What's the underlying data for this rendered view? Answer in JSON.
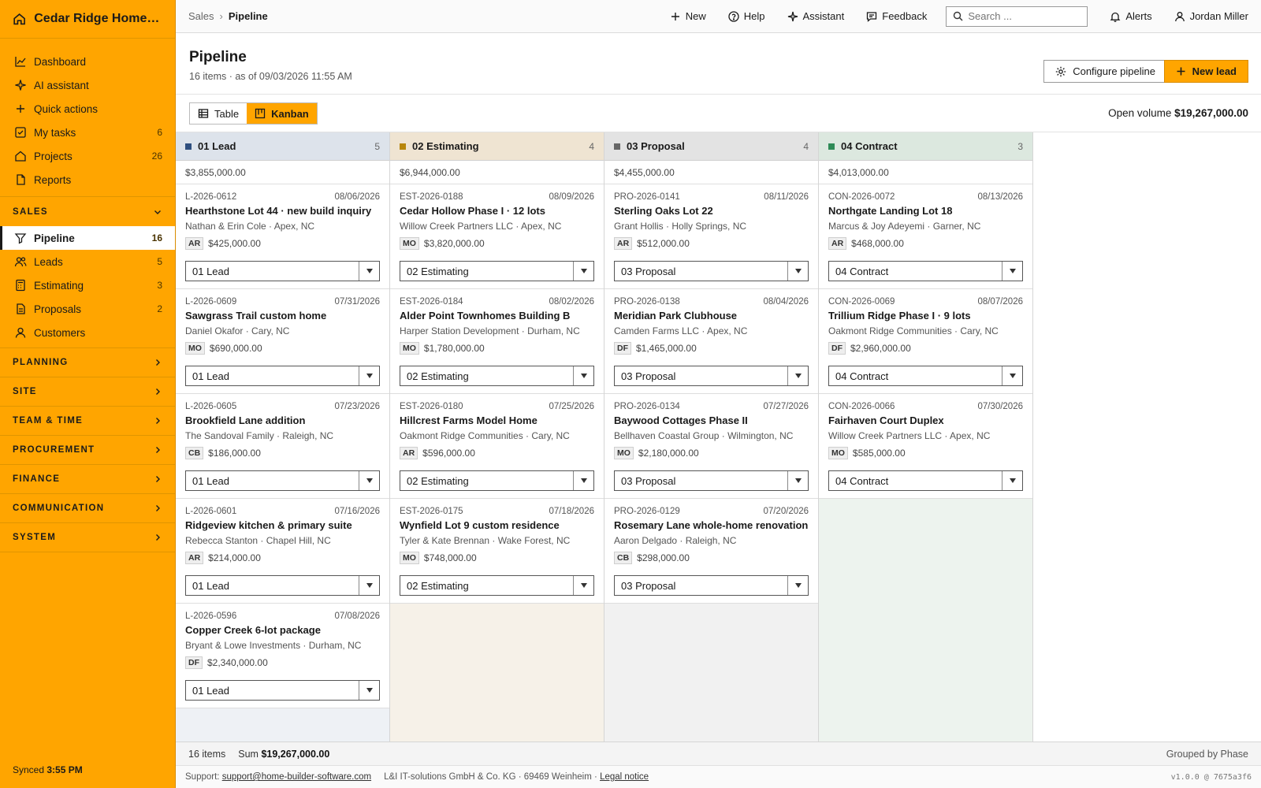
{
  "app": {
    "brand": "Cedar Ridge Homes L...",
    "synced_label": "Synced",
    "synced_time": "3:55 PM"
  },
  "sidebar": {
    "top_items": [
      {
        "label": "Dashboard",
        "icon": "chart-line-icon"
      },
      {
        "label": "AI assistant",
        "icon": "sparkle-icon"
      },
      {
        "label": "Quick actions",
        "icon": "plus-icon"
      },
      {
        "label": "My tasks",
        "icon": "checkbox-icon",
        "count": "6"
      },
      {
        "label": "Projects",
        "icon": "home-icon",
        "count": "26"
      },
      {
        "label": "Reports",
        "icon": "document-icon"
      }
    ],
    "sales_section": "SALES",
    "sales_items": [
      {
        "label": "Pipeline",
        "icon": "filter-icon",
        "count": "16",
        "active": true
      },
      {
        "label": "Leads",
        "icon": "users-icon",
        "count": "5"
      },
      {
        "label": "Estimating",
        "icon": "calculator-icon",
        "count": "3"
      },
      {
        "label": "Proposals",
        "icon": "file-icon",
        "count": "2"
      },
      {
        "label": "Customers",
        "icon": "user-icon"
      }
    ],
    "sections": [
      "PLANNING",
      "SITE",
      "TEAM & TIME",
      "PROCUREMENT",
      "FINANCE",
      "COMMUNICATION",
      "SYSTEM"
    ]
  },
  "topbar": {
    "breadcrumb_parent": "Sales",
    "breadcrumb_current": "Pipeline",
    "new_label": "New",
    "help_label": "Help",
    "assistant_label": "Assistant",
    "feedback_label": "Feedback",
    "search_placeholder": "Search ...",
    "alerts_label": "Alerts",
    "user_name": "Jordan Miller"
  },
  "header": {
    "title": "Pipeline",
    "subtitle": "16 items · as of 09/03/2026 11:55 AM",
    "configure_label": "Configure pipeline",
    "new_lead_label": "New lead"
  },
  "view": {
    "table_label": "Table",
    "kanban_label": "Kanban",
    "open_volume_label": "Open volume",
    "open_volume_value": "$19,267,000.00"
  },
  "colors": {
    "accent": "#ffa500",
    "lead": "#2f4f7f",
    "estimating": "#b8860b",
    "proposal": "#666666",
    "contract": "#2e8b57"
  },
  "columns": [
    {
      "name": "01 Lead",
      "count": "5",
      "sum": "$3,855,000.00",
      "head_bg": "#dde3eb",
      "body_bg": "#eef1f5",
      "dot": "#2f4f7f",
      "cards": [
        {
          "ref": "L-2026-0612",
          "date": "08/06/2026",
          "title": "Hearthstone Lot 44 · new build inquiry",
          "client": "Nathan & Erin Cole · Apex, NC",
          "owner": "AR",
          "value": "$425,000.00",
          "stage": "01 Lead"
        },
        {
          "ref": "L-2026-0609",
          "date": "07/31/2026",
          "title": "Sawgrass Trail custom home",
          "client": "Daniel Okafor · Cary, NC",
          "owner": "MO",
          "value": "$690,000.00",
          "stage": "01 Lead"
        },
        {
          "ref": "L-2026-0605",
          "date": "07/23/2026",
          "title": "Brookfield Lane addition",
          "client": "The Sandoval Family · Raleigh, NC",
          "owner": "CB",
          "value": "$186,000.00",
          "stage": "01 Lead"
        },
        {
          "ref": "L-2026-0601",
          "date": "07/16/2026",
          "title": "Ridgeview kitchen & primary suite",
          "client": "Rebecca Stanton · Chapel Hill, NC",
          "owner": "AR",
          "value": "$214,000.00",
          "stage": "01 Lead"
        },
        {
          "ref": "L-2026-0596",
          "date": "07/08/2026",
          "title": "Copper Creek 6-lot package",
          "client": "Bryant & Lowe Investments · Durham, NC",
          "owner": "DF",
          "value": "$2,340,000.00",
          "stage": "01 Lead"
        }
      ]
    },
    {
      "name": "02 Estimating",
      "count": "4",
      "sum": "$6,944,000.00",
      "head_bg": "#efe4d2",
      "body_bg": "#f6f1e8",
      "dot": "#b8860b",
      "cards": [
        {
          "ref": "EST-2026-0188",
          "date": "08/09/2026",
          "title": "Cedar Hollow Phase I · 12 lots",
          "client": "Willow Creek Partners LLC · Apex, NC",
          "owner": "MO",
          "value": "$3,820,000.00",
          "stage": "02 Estimating"
        },
        {
          "ref": "EST-2026-0184",
          "date": "08/02/2026",
          "title": "Alder Point Townhomes Building B",
          "client": "Harper Station Development · Durham, NC",
          "owner": "MO",
          "value": "$1,780,000.00",
          "stage": "02 Estimating"
        },
        {
          "ref": "EST-2026-0180",
          "date": "07/25/2026",
          "title": "Hillcrest Farms Model Home",
          "client": "Oakmont Ridge Communities · Cary, NC",
          "owner": "AR",
          "value": "$596,000.00",
          "stage": "02 Estimating"
        },
        {
          "ref": "EST-2026-0175",
          "date": "07/18/2026",
          "title": "Wynfield Lot 9 custom residence",
          "client": "Tyler & Kate Brennan · Wake Forest, NC",
          "owner": "MO",
          "value": "$748,000.00",
          "stage": "02 Estimating"
        }
      ]
    },
    {
      "name": "03 Proposal",
      "count": "4",
      "sum": "$4,455,000.00",
      "head_bg": "#e3e3e3",
      "body_bg": "#f1f1f1",
      "dot": "#666666",
      "cards": [
        {
          "ref": "PRO-2026-0141",
          "date": "08/11/2026",
          "title": "Sterling Oaks Lot 22",
          "client": "Grant Hollis · Holly Springs, NC",
          "owner": "AR",
          "value": "$512,000.00",
          "stage": "03 Proposal"
        },
        {
          "ref": "PRO-2026-0138",
          "date": "08/04/2026",
          "title": "Meridian Park Clubhouse",
          "client": "Camden Farms LLC · Apex, NC",
          "owner": "DF",
          "value": "$1,465,000.00",
          "stage": "03 Proposal"
        },
        {
          "ref": "PRO-2026-0134",
          "date": "07/27/2026",
          "title": "Baywood Cottages Phase II",
          "client": "Bellhaven Coastal Group · Wilmington, NC",
          "owner": "MO",
          "value": "$2,180,000.00",
          "stage": "03 Proposal"
        },
        {
          "ref": "PRO-2026-0129",
          "date": "07/20/2026",
          "title": "Rosemary Lane whole-home renovation",
          "client": "Aaron Delgado · Raleigh, NC",
          "owner": "CB",
          "value": "$298,000.00",
          "stage": "03 Proposal"
        }
      ]
    },
    {
      "name": "04 Contract",
      "count": "3",
      "sum": "$4,013,000.00",
      "head_bg": "#dce8df",
      "body_bg": "#edf3ee",
      "dot": "#2e8b57",
      "cards": [
        {
          "ref": "CON-2026-0072",
          "date": "08/13/2026",
          "title": "Northgate Landing Lot 18",
          "client": "Marcus & Joy Adeyemi · Garner, NC",
          "owner": "AR",
          "value": "$468,000.00",
          "stage": "04 Contract"
        },
        {
          "ref": "CON-2026-0069",
          "date": "08/07/2026",
          "title": "Trillium Ridge Phase I · 9 lots",
          "client": "Oakmont Ridge Communities · Cary, NC",
          "owner": "DF",
          "value": "$2,960,000.00",
          "stage": "04 Contract"
        },
        {
          "ref": "CON-2026-0066",
          "date": "07/30/2026",
          "title": "Fairhaven Court Duplex",
          "client": "Willow Creek Partners LLC · Apex, NC",
          "owner": "MO",
          "value": "$585,000.00",
          "stage": "04 Contract"
        }
      ]
    }
  ],
  "statusbar": {
    "items": "16 items",
    "sum_label": "Sum",
    "sum_value": "$19,267,000.00",
    "grouped": "Grouped by Phase"
  },
  "footer": {
    "support_label": "Support:",
    "support_email": "support@home-builder-software.com",
    "company": "L&I IT-solutions GmbH & Co. KG · 69469 Weinheim ·",
    "legal": "Legal notice",
    "version": "v1.0.0 @ 7675a3f6"
  }
}
